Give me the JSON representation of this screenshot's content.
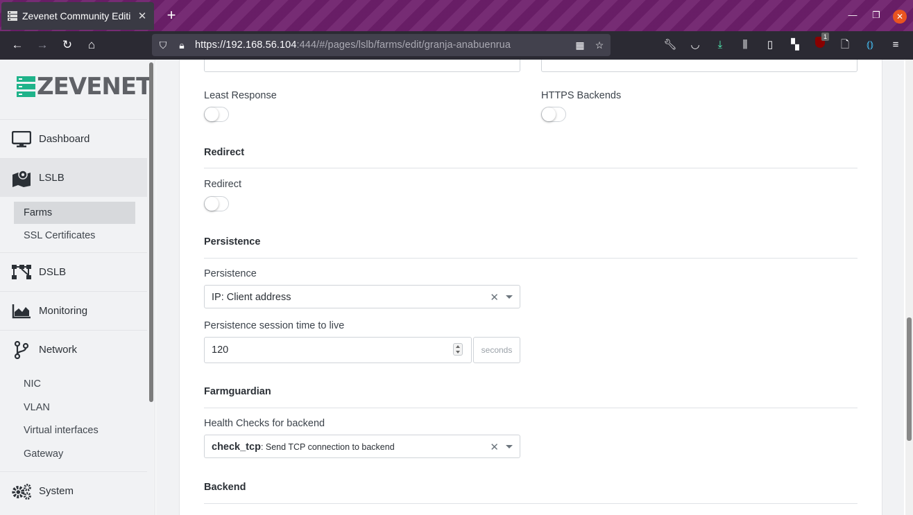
{
  "browser": {
    "tab_title": "Zevenet Community Editi",
    "new_tab": "+",
    "url_host": "https://192.168.56.104",
    "url_rest": ":444/#/pages/lslb/farms/edit/granja-anabuenrua",
    "badge_count": "1"
  },
  "sidebar": {
    "logo_text": "ZEVENET",
    "items": [
      {
        "label": "Dashboard",
        "icon": "monitor-icon"
      },
      {
        "label": "LSLB",
        "icon": "map-icon"
      },
      {
        "label": "DSLB",
        "icon": "network-nodes-icon"
      },
      {
        "label": "Monitoring",
        "icon": "area-chart-icon"
      },
      {
        "label": "Network",
        "icon": "branch-icon"
      },
      {
        "label": "System",
        "icon": "gears-icon"
      }
    ],
    "lslb_sub": [
      "Farms",
      "SSL Certificates"
    ],
    "network_sub": [
      "NIC",
      "VLAN",
      "Virtual interfaces",
      "Gateway"
    ]
  },
  "form": {
    "least_response_label": "Least Response",
    "https_backends_label": "HTTPS Backends",
    "redirect_section": "Redirect",
    "redirect_label": "Redirect",
    "persistence_section": "Persistence",
    "persistence_label": "Persistence",
    "persistence_value": "IP: Client address",
    "ttl_label": "Persistence session time to live",
    "ttl_value": "120",
    "ttl_unit": "seconds",
    "farmguardian_section": "Farmguardian",
    "health_label": "Health Checks for backend",
    "health_value_bold": "check_tcp",
    "health_value_rest": ": Send TCP connection to backend",
    "backend_section": "Backend"
  },
  "toggles": {
    "least_response": "off",
    "https_backends": "off",
    "redirect": "off"
  },
  "colors": {
    "accent": "#1fb38a",
    "tabbar": "#6e1f6b"
  }
}
